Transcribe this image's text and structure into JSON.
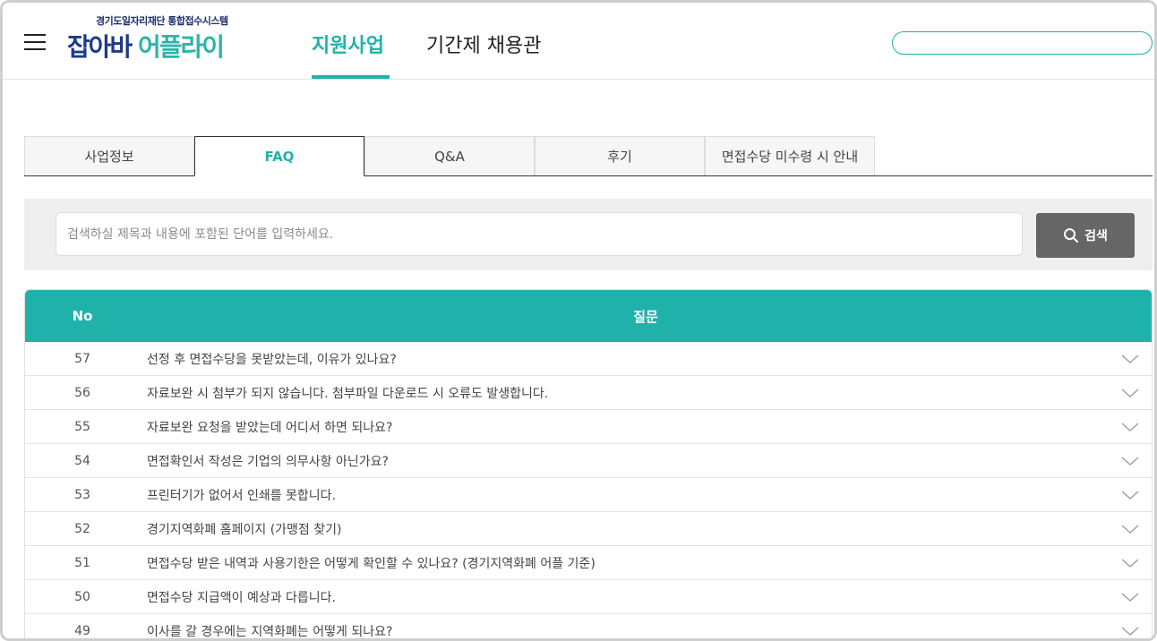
{
  "header": {
    "logo_sub": "경기도일자리재단 통합접수시스템",
    "logo_main_part1": "잡아바",
    "logo_main_part2": "어플라이",
    "nav": [
      {
        "label": "지원사업",
        "active": true
      },
      {
        "label": "기간제 채용관",
        "active": false
      }
    ],
    "search_value": ""
  },
  "tabs": [
    {
      "label": "사업정보",
      "active": false
    },
    {
      "label": "FAQ",
      "active": true
    },
    {
      "label": "Q&A",
      "active": false
    },
    {
      "label": "후기",
      "active": false
    },
    {
      "label": "면접수당 미수령 시 안내",
      "active": false
    }
  ],
  "search": {
    "placeholder": "검색하실 제목과 내용에 포함된 단어를 입력하세요.",
    "value": "",
    "button_label": "검색"
  },
  "table": {
    "col_no": "No",
    "col_question": "질문",
    "rows": [
      {
        "no": "57",
        "question": "선정 후 면접수당을 못받았는데, 이유가 있나요?"
      },
      {
        "no": "56",
        "question": "자료보완 시 첨부가 되지 않습니다. 첨부파일 다운로드 시 오류도 발생합니다."
      },
      {
        "no": "55",
        "question": "자료보완 요청을 받았는데 어디서 하면 되나요?"
      },
      {
        "no": "54",
        "question": "면접확인서 작성은 기업의 의무사항 아닌가요?"
      },
      {
        "no": "53",
        "question": "프린터기가 없어서 인쇄를 못합니다."
      },
      {
        "no": "52",
        "question": "경기지역화폐 홈페이지 (가맹점 찾기)"
      },
      {
        "no": "51",
        "question": "면접수당 받은 내역과 사용기한은 어떻게 확인할 수 있나요? (경기지역화폐 어플 기준)"
      },
      {
        "no": "50",
        "question": "면접수당 지급액이 예상과 다릅니다."
      },
      {
        "no": "49",
        "question": "이사를 갈 경우에는 지역화폐는 어떻게 되나요?"
      }
    ]
  },
  "colors": {
    "accent": "#20b2aa",
    "logo_navy": "#1d3a8a",
    "button_gray": "#666666"
  },
  "icons": [
    "hamburger-menu-icon",
    "search-icon",
    "chevron-down-icon"
  ]
}
